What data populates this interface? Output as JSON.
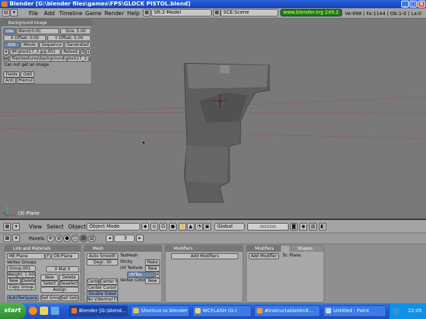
{
  "window": {
    "title": "Blender [G:\\blender files\\games\\FPS\\GLOCK PISTOL.blend]",
    "controls": [
      "_",
      "□",
      "X"
    ]
  },
  "info_header": {
    "menus": [
      "File",
      "Add",
      "Timeline",
      "Game",
      "Render",
      "Help"
    ],
    "screen": "SR:2-Model",
    "scene": "SCE:Scene",
    "url": "www.blender.org 249.2",
    "stats": "Ve:898 | Fa:1144 | Ob:1-0 | La:0"
  },
  "background_panel": {
    "title": "Background Image",
    "use_label": "Use",
    "blend": "Blend:0.0C",
    "size": "Size: 5.00",
    "x_offset": "X Offset: 0.00",
    "y_offset": "Y Offset: 5.00",
    "tabs": [
      "Still",
      "Movie",
      "Sequence",
      "Generated"
    ],
    "image_name": "IM:glock17_3.jpg.001",
    "reload": "Reload",
    "x_btn": "X",
    "one_btn": "1",
    "path": "files\\textures\\background\\glock17_3.jpg",
    "error": "Can not get an image",
    "fields": "Fields",
    "odd": "Odd",
    "anti": "Anti",
    "premul": "Premul"
  },
  "viewport": {
    "object_label": "(3) Plane",
    "bg": "#797979"
  },
  "view3d_header": {
    "menus": [
      "View",
      "Select",
      "Object"
    ],
    "mode": "Object Mode",
    "orientation": "Global"
  },
  "buttons_header": {
    "panels_label": "Panels",
    "frame": "3"
  },
  "buttons": {
    "link_materials": {
      "title": "Link and Materials",
      "me": "ME:Plane",
      "f": "F",
      "ob": "OB:Plane",
      "vertex_groups": "Vertex Groups",
      "group": "Group.001",
      "weight": "Weight: 1.000",
      "new": "New",
      "delete": "Delete",
      "copy_group": "Copy Group",
      "mat_count": "0 Mat 0",
      "new2": "New",
      "delete2": "Delete",
      "select": "Select",
      "deselect": "Deselect",
      "assign": "Assign",
      "autotexspace": "AutoTexSpace",
      "set_smooth": "Set Smooth",
      "set_solid": "Set Solid"
    },
    "mesh": {
      "title": "Mesh",
      "auto_smooth": "Auto Smooth",
      "degr": "Degr: 30",
      "texmesh": "TexMesh",
      "sticky": "Sticky",
      "make": "Make",
      "uv_texture": "UV Texture",
      "new": "New",
      "uvtex": "UVTex",
      "vertex_color": "Vertex Color",
      "new2": "New",
      "center": "Center",
      "center_new": "Center New",
      "center_cursor": "Center Cursor",
      "double_sided": "Double Sided",
      "no_vnormal_flip": "No V.Normal Flip"
    },
    "modifiers": {
      "title": "Modifiers",
      "add": "Add Modifiers"
    },
    "modifiers2": {
      "title": "Modifiers",
      "tab2": "Shapes",
      "add": "Add Modifier",
      "to": "To: Plane"
    }
  },
  "taskbar": {
    "start": "start",
    "tasks": [
      {
        "label": "Blender [G:\\blend...",
        "color": "#e87a1c"
      },
      {
        "label": "Shortcut to blender",
        "color": "#e0c060"
      },
      {
        "label": "WCFLASH (G:)",
        "color": "#f0d070"
      },
      {
        "label": "#instructableId=E...",
        "color": "#ff9933"
      },
      {
        "label": "Untitled - Paint",
        "color": "#c0d8ff"
      }
    ],
    "clock": "22:05"
  }
}
